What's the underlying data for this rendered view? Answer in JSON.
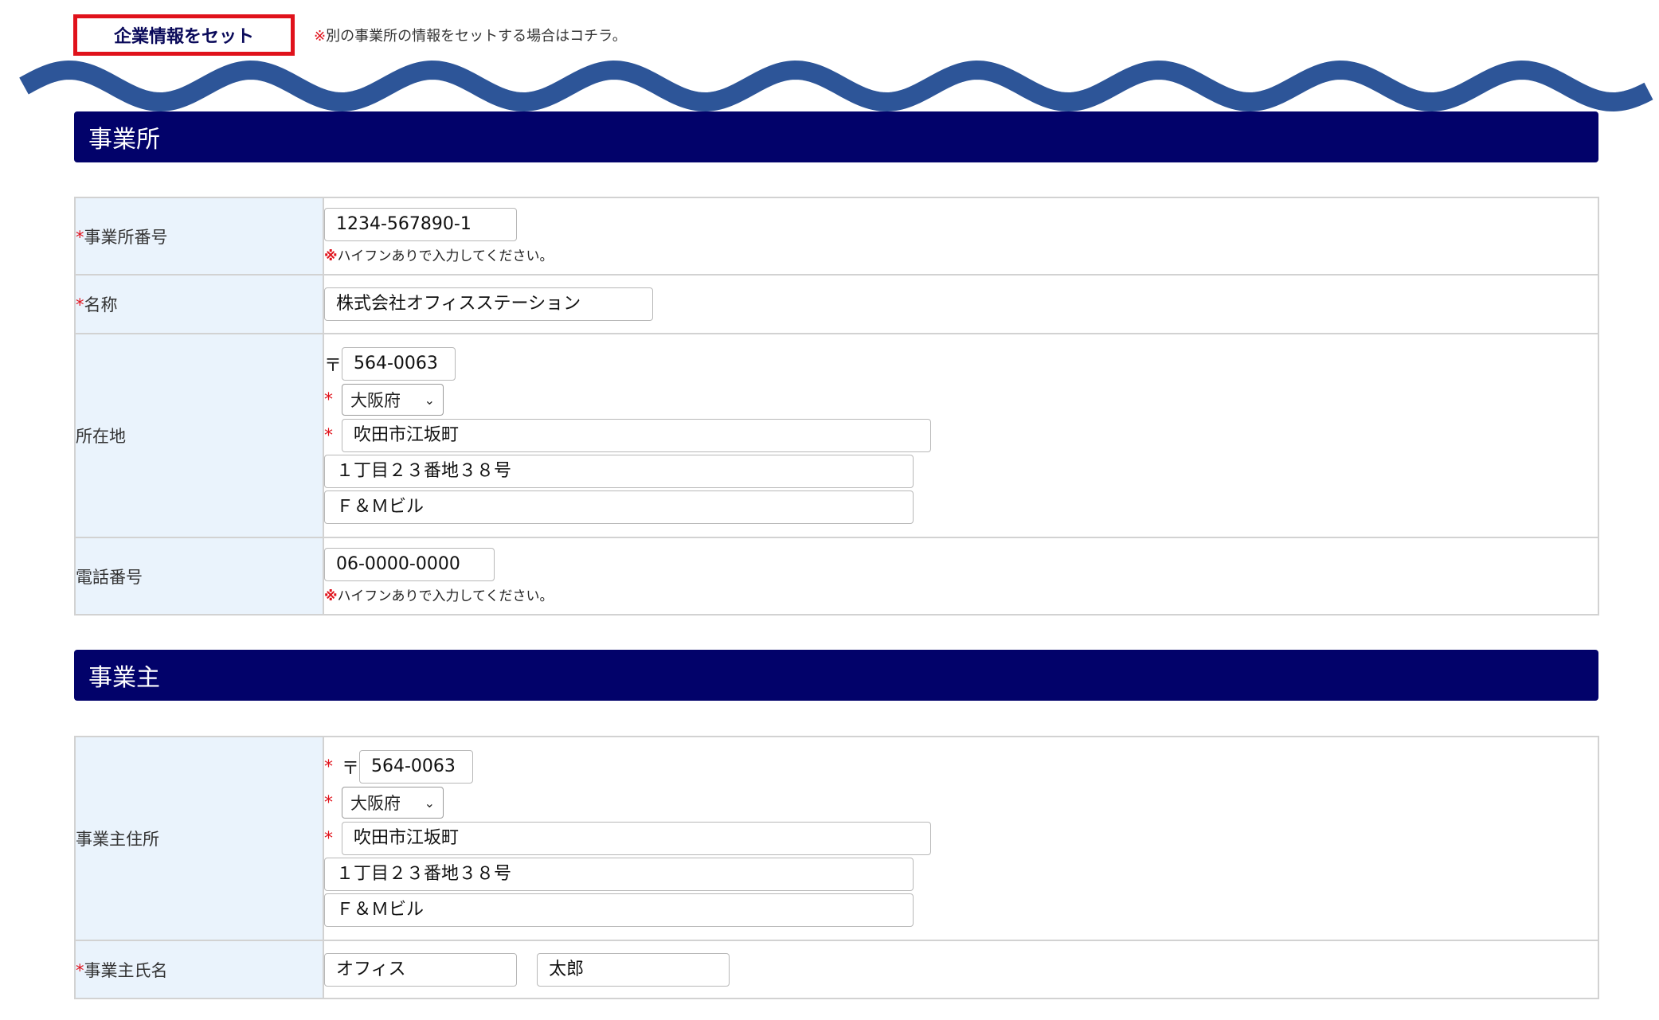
{
  "top": {
    "set_button_label": "企業情報をセット",
    "note_mark": "※",
    "note_text": "別の事業所の情報をセットする場合はコチラ。"
  },
  "colors": {
    "header_bg": "#02026a",
    "wave": "#2d5598",
    "required": "#e0121b",
    "label_bg": "#eaf3fc"
  },
  "office": {
    "header": "事業所",
    "number_label": "事業所番号",
    "number_value": "1234-567890-1",
    "number_note": "ハイフンありで入力してください。",
    "name_label": "名称",
    "name_value": "株式会社オフィスステーション",
    "address_label": "所在地",
    "postal_symbol": "〒",
    "postal_value": "564-0063",
    "prefecture": "大阪府",
    "city": "吹田市江坂町",
    "address1": "１丁目２３番地３８号",
    "address2": "Ｆ＆Ｍビル",
    "phone_label": "電話番号",
    "phone_value": "06-0000-0000",
    "phone_note": "ハイフンありで入力してください。"
  },
  "owner": {
    "header": "事業主",
    "address_label": "事業主住所",
    "postal_symbol": "〒",
    "postal_value": "564-0063",
    "prefecture": "大阪府",
    "city": "吹田市江坂町",
    "address1": "１丁目２３番地３８号",
    "address2": "Ｆ＆Ｍビル",
    "name_label": "事業主氏名",
    "last_name": "オフィス",
    "first_name": "太郎"
  },
  "marks": {
    "required": "*",
    "note": "※",
    "chevron": "⌄"
  }
}
